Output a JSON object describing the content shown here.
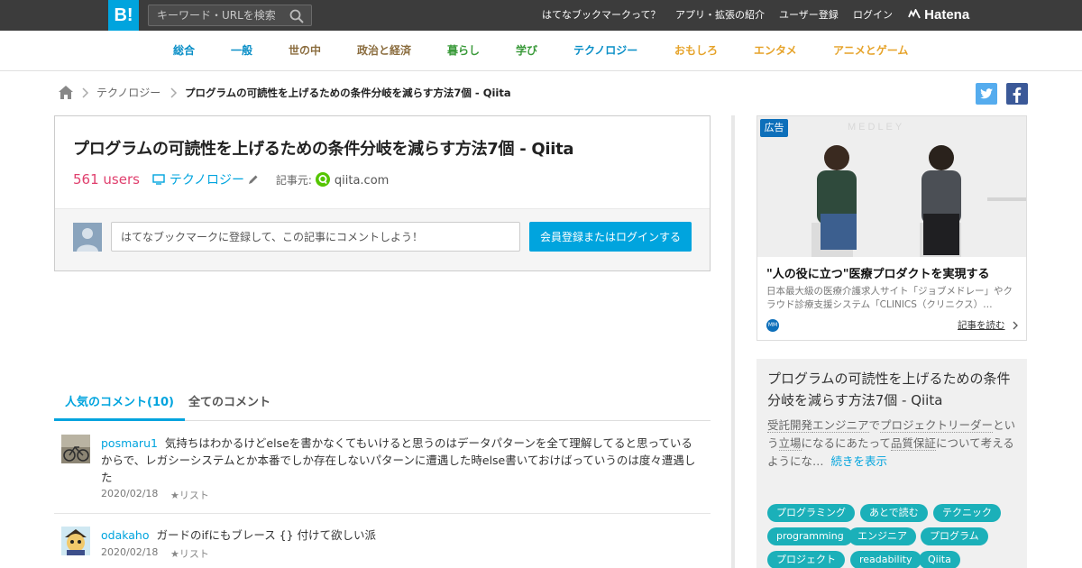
{
  "header": {
    "logo": "B!",
    "search_placeholder": "キーワード・URLを検索",
    "links": [
      "はてなブックマークって？",
      "アプリ・拡張の紹介",
      "ユーザー登録",
      "ログイン"
    ],
    "brand": "Hatena"
  },
  "categories": [
    {
      "label": "総合",
      "color": "#0a8fc7"
    },
    {
      "label": "一般",
      "color": "#0a8fc7"
    },
    {
      "label": "世の中",
      "color": "#8b6d3f"
    },
    {
      "label": "政治と経済",
      "color": "#8b6d3f"
    },
    {
      "label": "暮らし",
      "color": "#3a9a3a"
    },
    {
      "label": "学び",
      "color": "#3a9a3a"
    },
    {
      "label": "テクノロジー",
      "color": "#0a8fc7"
    },
    {
      "label": "おもしろ",
      "color": "#e6a32a"
    },
    {
      "label": "エンタメ",
      "color": "#e6a32a"
    },
    {
      "label": "アニメとゲーム",
      "color": "#e6a32a"
    }
  ],
  "breadcrumb": {
    "category": "テクノロジー",
    "current": "プログラムの可読性を上げるための条件分岐を減らす方法7個 - Qiita"
  },
  "entry": {
    "title": "プログラムの可読性を上げるための条件分岐を減らす方法7個 - Qiita",
    "users": "561 users",
    "category": "テクノロジー",
    "source_label": "記事元:",
    "source": "qiita.com",
    "comment_placeholder": "はてなブックマークに登録して、この記事にコメントしよう！",
    "login_button": "会員登録またはログインする"
  },
  "comment_tabs": {
    "popular": "人気のコメント(10)",
    "all": "全てのコメント"
  },
  "comments": [
    {
      "user": "posmaru1",
      "text": "気持ちはわかるけどelseを書かなくてもいけると思うのはデータパターンを全て理解してると思っているからで、レガシーシステムとか本番でしか存在しないパターンに遭遇した時else書いておけばっていうのは度々遭遇した",
      "date": "2020/02/18",
      "list": "★リスト"
    },
    {
      "user": "odakaho",
      "text": "ガードのifにもブレース {} 付けて欲しい派",
      "date": "2020/02/18",
      "list": "★リスト"
    }
  ],
  "ad": {
    "badge": "広告",
    "brand": "MEDLEY",
    "headline": "\"人の役に立つ\"医療プロダクトを実現する",
    "description": "日本最大級の医療介護求人サイト「ジョブメドレー」やクラウド診療支援システム「CLINICS（クリニクス）…",
    "read_more": "記事を読む"
  },
  "summary": {
    "title": "プログラムの可読性を上げるための条件分岐を減らす方法7個 - Qiita",
    "text_parts": [
      "受託開発",
      "エンジニア",
      "で",
      "プロジェクトリーダー",
      "という",
      "立場",
      "になるにあたって",
      "品質保証",
      "について考えるようにな…"
    ],
    "more": "続きを表示",
    "tags": [
      "プログラミング",
      "あとで読む",
      "テクニック",
      "programming",
      "エンジニア",
      "プログラム",
      "プロジェクト",
      "readability",
      "Qiita"
    ]
  },
  "colors": {
    "accent": "#00a4de",
    "users": "#e0406e",
    "tag": "#1bb0b9",
    "topbar": "#3c3c3c"
  }
}
